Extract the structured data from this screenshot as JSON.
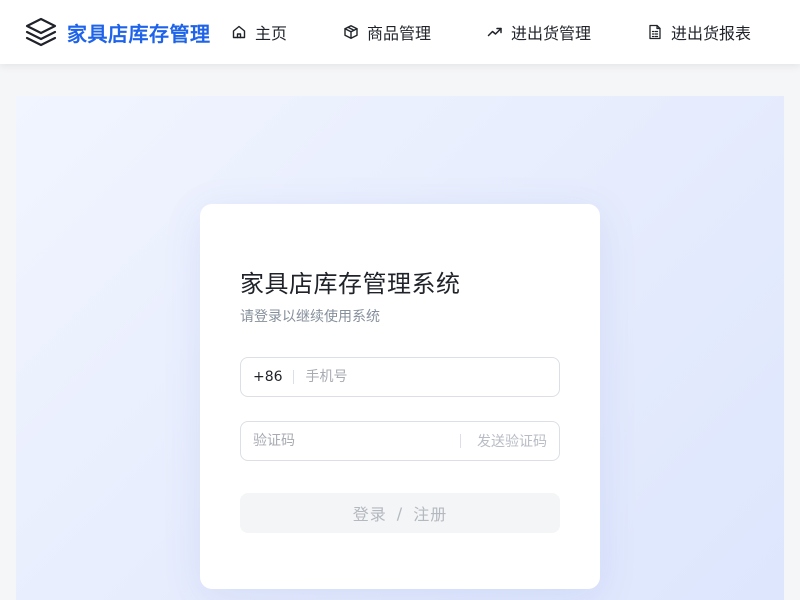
{
  "nav": {
    "brand": {
      "title": "家具店库存管理",
      "icon": "layers-icon",
      "color": "#1e63e9"
    },
    "items": [
      {
        "label": "主页",
        "icon": "home-icon"
      },
      {
        "label": "商品管理",
        "icon": "box-icon"
      },
      {
        "label": "进出货管理",
        "icon": "trending-up-icon"
      },
      {
        "label": "进出货报表",
        "icon": "report-icon"
      }
    ]
  },
  "login": {
    "title": "家具店库存管理系统",
    "subtitle": "请登录以继续使用系统",
    "phone": {
      "prefix": "+86",
      "placeholder": "手机号",
      "value": ""
    },
    "code": {
      "placeholder": "验证码",
      "value": "",
      "send_label": "发送验证码"
    },
    "submit": {
      "login_label": "登录",
      "separator": "/",
      "register_label": "注册"
    }
  }
}
